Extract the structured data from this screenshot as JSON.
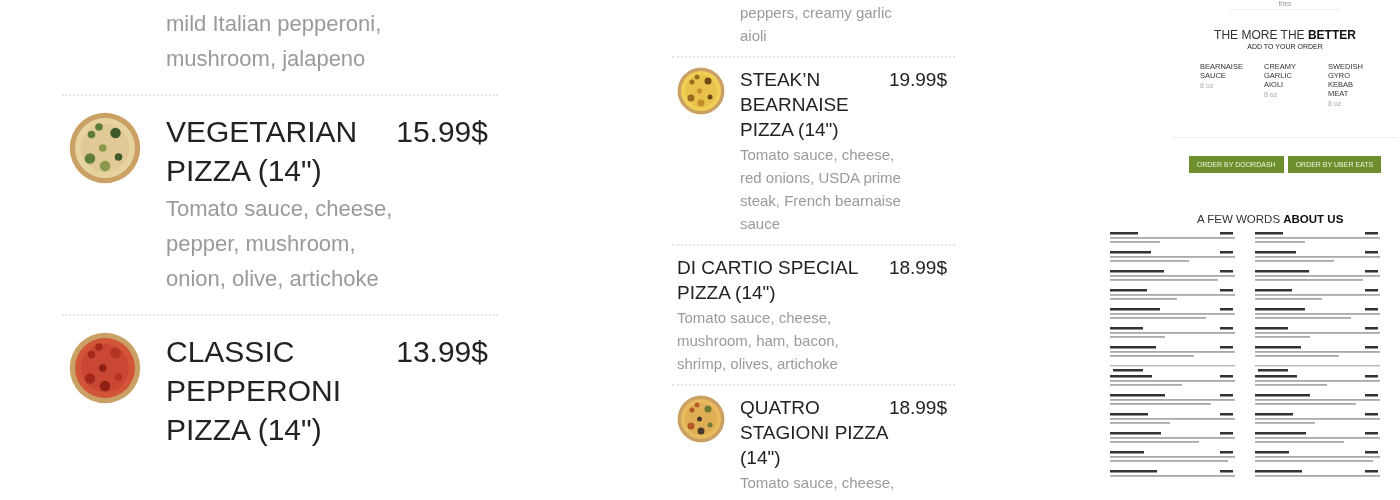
{
  "left_menu": {
    "items": [
      {
        "description": "mild Italian pepperoni, mushroom, jalapeno"
      },
      {
        "title": "VEGETARIAN PIZZA (14\")",
        "price": "15.99$",
        "image": {
          "kind": "picture"
        },
        "description": "Tomato sauce, cheese, pepper, mushroom, onion, olive, artichoke"
      },
      {
        "title": "CLASSIC PEPPERONI PIZZA (14\")",
        "price": "13.99$",
        "image": {
          "kind": "picture"
        }
      }
    ]
  },
  "middle_menu": {
    "items": [
      {
        "description": "peppers, creamy garlic aioli"
      },
      {
        "title": "STEAK’N BEARNAISE PIZZA (14\")",
        "price": "19.99$",
        "image": {
          "kind": "picture"
        },
        "description": "Tomato sauce, cheese, red onions, USDA prime steak, French bearnaise sauce"
      },
      {
        "title": "DI CARTIO SPECIAL PIZZA (14\")",
        "price": "18.99$",
        "description": "Tomato sauce, cheese, mushroom, ham, bacon, shrimp, olives, artichoke"
      },
      {
        "title": "QUATRO STAGIONI PIZZA (14\")",
        "price": "18.99$",
        "image": {
          "kind": "picture"
        },
        "description": "Tomato sauce, cheese,"
      }
    ]
  },
  "side_preview": {
    "top_note": "fries",
    "addons_heading": {
      "light": "THE MORE THE",
      "bold": "BETTER"
    },
    "addons_subheading": "ADD TO YOUR ORDER",
    "addons": [
      {
        "name": "BEARNAISE SAUCE",
        "size": "8 oz"
      },
      {
        "name": "CREAMY GARLIC AIOLI",
        "size": "8 oz"
      },
      {
        "name": "SWEDISH GYRO KEBAB MEAT",
        "size": "8 oz"
      }
    ],
    "buttons": [
      "ORDER BY DOORDASH",
      "ORDER BY UBER EATS"
    ],
    "about_heading": {
      "light": "A FEW WORDS",
      "bold": "ABOUT US"
    },
    "menu_image": {
      "kind": "picture"
    }
  }
}
